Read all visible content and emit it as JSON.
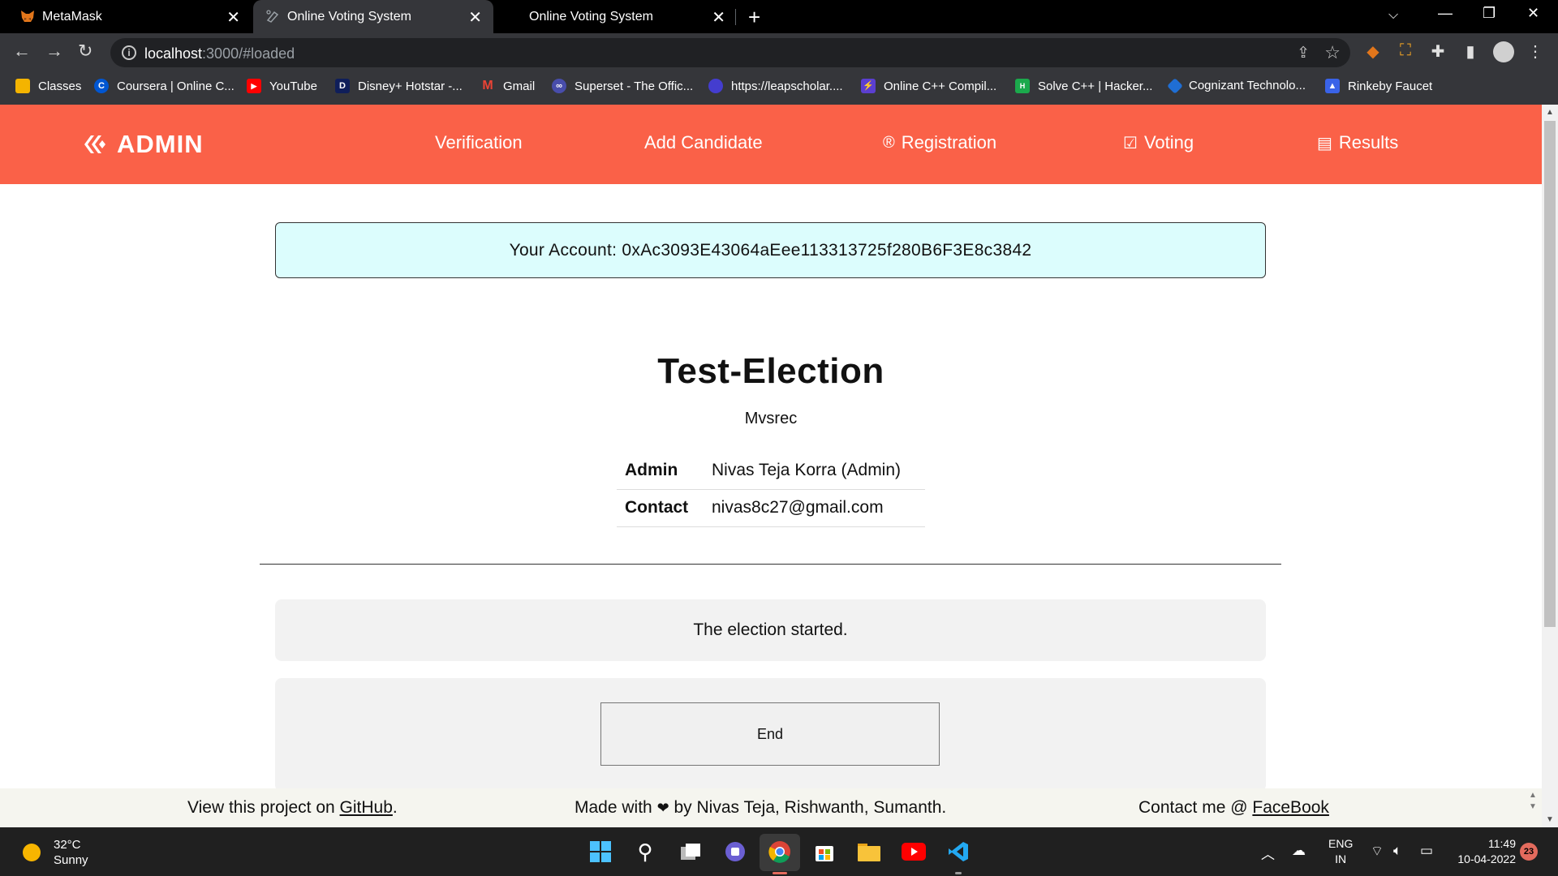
{
  "browser": {
    "tabs": [
      {
        "title": "MetaMask",
        "active": false
      },
      {
        "title": "Online Voting System",
        "active": true
      },
      {
        "title": "Online Voting System",
        "active": false
      }
    ],
    "url_host": "localhost",
    "url_rest": ":3000/#loaded",
    "bookmarks": [
      {
        "label": "Classes",
        "icon_color": "#f4b400"
      },
      {
        "label": "Coursera | Online C...",
        "icon_color": "#0056d2"
      },
      {
        "label": "YouTube",
        "icon_color": "#ff0000"
      },
      {
        "label": "Disney+ Hotstar -...",
        "icon_color": "#0f1e5a"
      },
      {
        "label": "Gmail",
        "icon_color": "#ea4335"
      },
      {
        "label": "Superset - The Offic...",
        "icon_color": "#484dab"
      },
      {
        "label": "https://leapscholar....",
        "icon_color": "#443dcf"
      },
      {
        "label": "Online C++ Compil...",
        "icon_color": "#5b3fd1"
      },
      {
        "label": "Solve C++ | Hacker...",
        "icon_color": "#1ba94c"
      },
      {
        "label": "Cognizant Technolo...",
        "icon_color": "#1f6ed4"
      },
      {
        "label": "Rinkeby Faucet",
        "icon_color": "#3a63e8"
      }
    ]
  },
  "navbar": {
    "brand": "ADMIN",
    "links": [
      {
        "label": "Verification"
      },
      {
        "label": "Add Candidate"
      },
      {
        "label": "Registration"
      },
      {
        "label": "Voting"
      },
      {
        "label": "Results"
      }
    ],
    "accent_color": "#fa6148"
  },
  "account": {
    "label": "Your Account: 0xAc3093E43064aEee113313725f280B6F3E8c3842"
  },
  "election": {
    "title": "Test-Election",
    "organization": "Mvsrec",
    "rows": [
      {
        "key": "Admin",
        "value": "Nivas Teja Korra (Admin)"
      },
      {
        "key": "Contact",
        "value": "nivas8c27@gmail.com"
      }
    ]
  },
  "status": {
    "message": "The election started."
  },
  "controls": {
    "end_label": "End"
  },
  "footer": {
    "left_prefix": "View this project on ",
    "left_link": "GitHub",
    "left_suffix": ".",
    "mid_prefix": "Made with",
    "mid_suffix": " by Nivas Teja, Rishwanth, Sumanth.",
    "right_prefix": "Contact me @ ",
    "right_link": "FaceBook"
  },
  "taskbar": {
    "temperature": "32°C",
    "condition": "Sunny",
    "lang_top": "ENG",
    "lang_bottom": "IN",
    "time": "11:49",
    "date": "10-04-2022",
    "notifications": "23"
  }
}
